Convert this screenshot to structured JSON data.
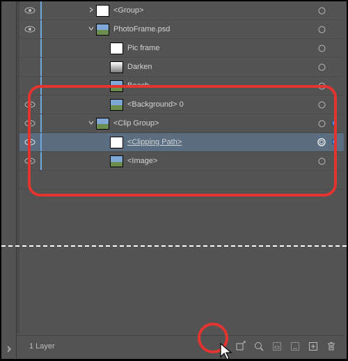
{
  "layers": {
    "items": [
      {
        "label": "<Group>"
      },
      {
        "label": "PhotoFrame.psd"
      },
      {
        "label": "Pic frame"
      },
      {
        "label": "Darken"
      },
      {
        "label": "Beach"
      },
      {
        "label": "<Background> 0"
      },
      {
        "label": "<Clip Group>"
      },
      {
        "label": "<Clipping Path>"
      },
      {
        "label": "<Image>"
      }
    ]
  },
  "footer": {
    "count_label": "1 Layer"
  }
}
